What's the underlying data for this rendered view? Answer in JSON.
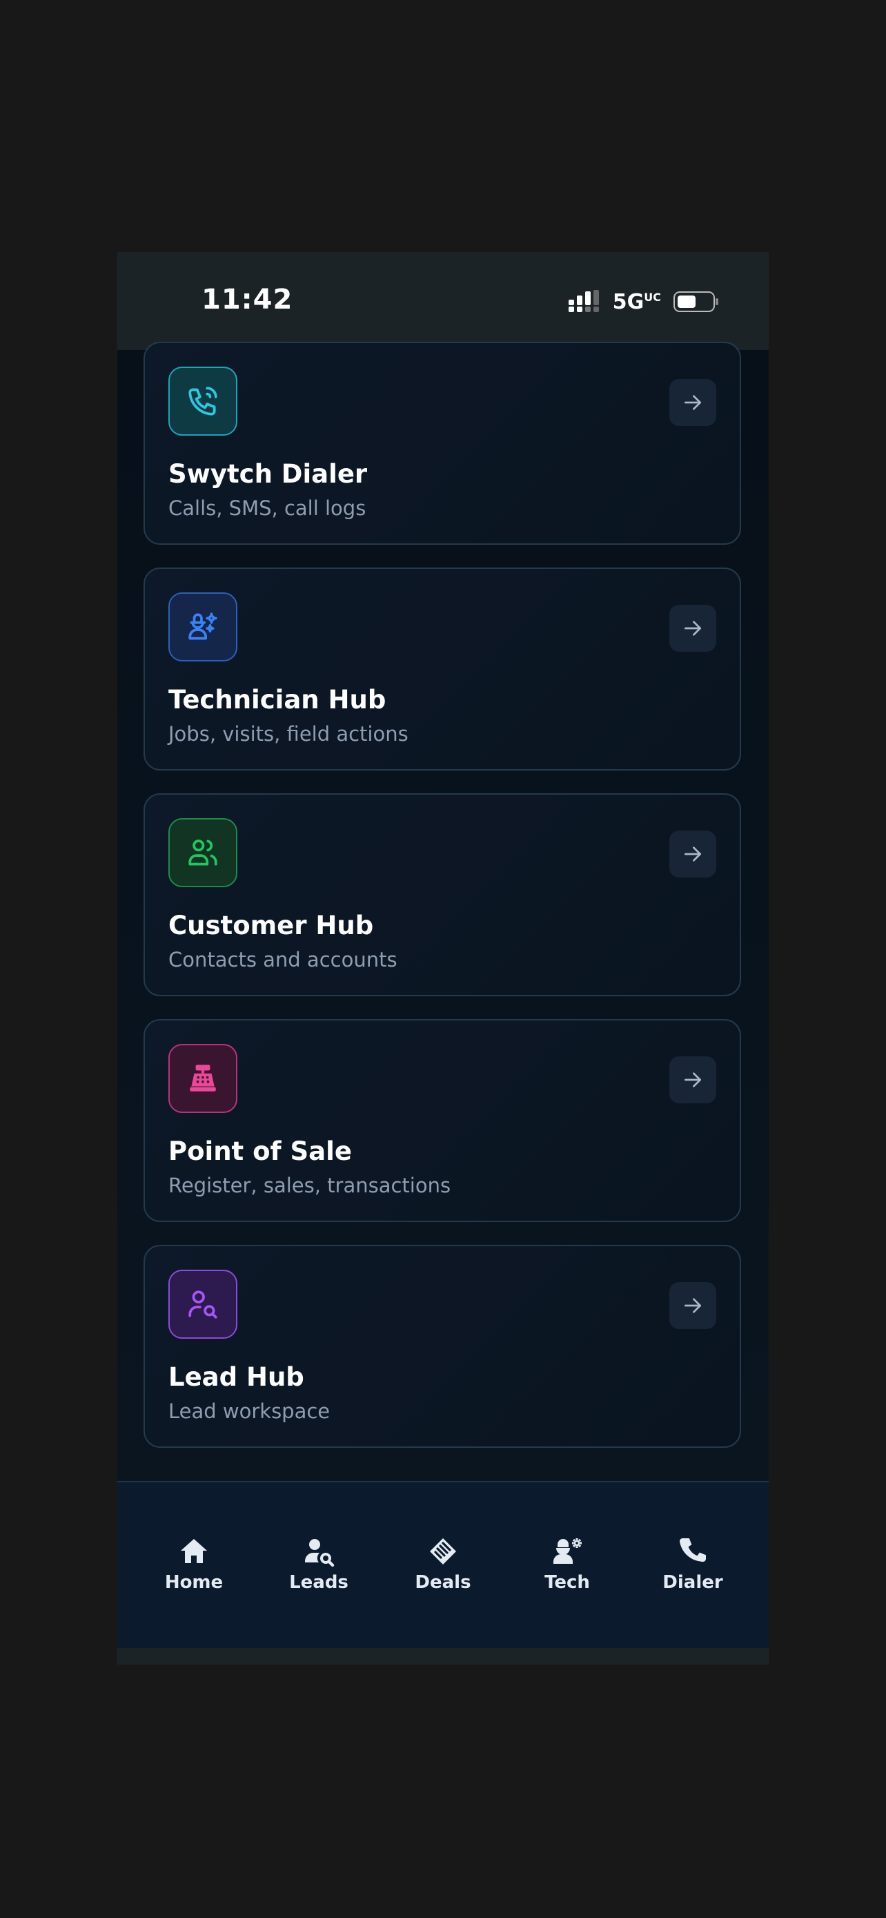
{
  "status": {
    "time": "11:42",
    "network": "5G",
    "network_sup": "UC"
  },
  "cards": [
    {
      "title": "Swytch Dialer",
      "subtitle": "Calls, SMS, call logs",
      "icon": "phone-call-icon",
      "accent": "#22b8cf"
    },
    {
      "title": "Technician Hub",
      "subtitle": "Jobs, visits, field actions",
      "icon": "technician-icon",
      "accent": "#3b82f6"
    },
    {
      "title": "Customer Hub",
      "subtitle": "Contacts and accounts",
      "icon": "users-icon",
      "accent": "#22c55e"
    },
    {
      "title": "Point of Sale",
      "subtitle": "Register, sales, transactions",
      "icon": "cash-register-icon",
      "accent": "#ec4899"
    },
    {
      "title": "Lead Hub",
      "subtitle": "Lead workspace",
      "icon": "user-search-icon",
      "accent": "#a855f7"
    }
  ],
  "tabs": [
    {
      "label": "Home",
      "icon": "home-icon"
    },
    {
      "label": "Leads",
      "icon": "user-search-icon"
    },
    {
      "label": "Deals",
      "icon": "handshake-icon"
    },
    {
      "label": "Tech",
      "icon": "technician-icon"
    },
    {
      "label": "Dialer",
      "icon": "phone-icon"
    }
  ]
}
